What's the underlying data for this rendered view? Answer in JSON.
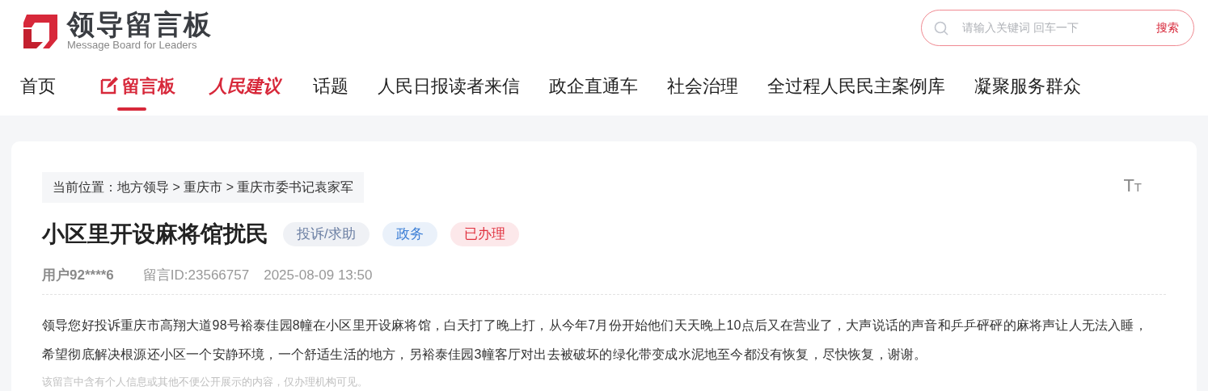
{
  "logo": {
    "title": "领导留言板",
    "subtitle": "Message Board for Leaders"
  },
  "search": {
    "placeholder": "请输入关键词 回车一下",
    "button": "搜索"
  },
  "nav": [
    {
      "label": "首页",
      "kind": "plain",
      "selected": false
    },
    {
      "label": "留言板",
      "kind": "icon",
      "selected": true
    },
    {
      "label": "人民建议",
      "kind": "script",
      "selected": false
    },
    {
      "label": "话题",
      "kind": "plain",
      "selected": false
    },
    {
      "label": "人民日报读者来信",
      "kind": "plain",
      "selected": false
    },
    {
      "label": "政企直通车",
      "kind": "plain",
      "selected": false
    },
    {
      "label": "社会治理",
      "kind": "plain",
      "selected": false
    },
    {
      "label": "全过程人民民主案例库",
      "kind": "plain",
      "selected": false
    },
    {
      "label": "凝聚服务群众",
      "kind": "plain",
      "selected": false
    }
  ],
  "breadcrumb": "当前位置：地方领导 > 重庆市 > 重庆市委书记袁家军",
  "font_size_button": {
    "large": "T",
    "small": "T"
  },
  "message": {
    "title": "小区里开设麻将馆扰民",
    "tags": [
      {
        "label": "投诉/求助",
        "color": "#6b7fa3"
      },
      {
        "label": "政务",
        "color": "#3d7fd6"
      },
      {
        "label": "已办理",
        "color": "#e0303e"
      }
    ],
    "user": "用户92****6",
    "id": "留言ID:23566757",
    "time": "2025-08-09 13:50",
    "body": "领导您好投诉重庆市高翔大道98号裕泰佳园8幢在小区里开设麻将馆，白天打了晚上打，从今年7月份开始他们天天晚上10点后又在营业了，大声说话的声音和乒乒砰砰的麻将声让人无法入睡，希望彻底解决根源还小区一个安静环境，一个舒适生活的地方，另裕泰佳园3幢客厅对出去被破坏的绿化带变成水泥地至今都没有恢复，尽快恢复，谢谢。",
    "note": "该留言中含有个人信息或其他不便公开展示的内容，仅办理机构可见。"
  }
}
